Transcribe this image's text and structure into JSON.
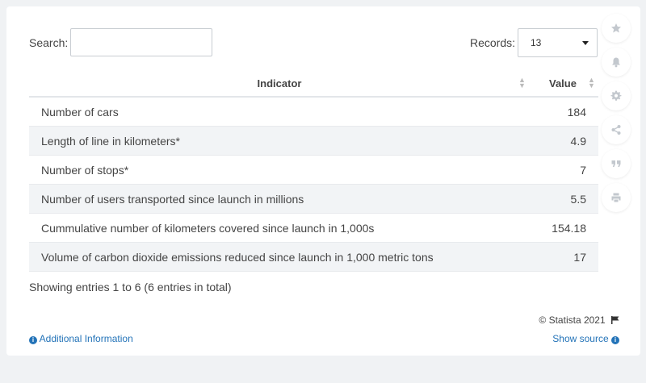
{
  "controls": {
    "search_label": "Search:",
    "search_value": "",
    "records_label": "Records:",
    "records_value": "13"
  },
  "table": {
    "headers": [
      "Indicator",
      "Value"
    ],
    "rows": [
      {
        "indicator": "Number of cars",
        "value": "184"
      },
      {
        "indicator": "Length of line in kilometers*",
        "value": "4.9"
      },
      {
        "indicator": "Number of stops*",
        "value": "7"
      },
      {
        "indicator": "Number of users transported since launch in millions",
        "value": "5.5"
      },
      {
        "indicator": "Cummulative number of kilometers covered since launch in 1,000s",
        "value": "154.18"
      },
      {
        "indicator": "Volume of carbon dioxide emissions reduced since launch in 1,000 metric tons",
        "value": "17"
      }
    ]
  },
  "footer": {
    "entries_info": "Showing entries 1 to 6 (6 entries in total)",
    "copyright": "© Statista 2021",
    "additional_info": "Additional Information",
    "show_source": "Show source"
  },
  "sidebar_icons": [
    "star-icon",
    "bell-icon",
    "gear-icon",
    "share-icon",
    "quote-icon",
    "print-icon"
  ],
  "colors": {
    "link": "#2373b8",
    "row_alt": "#f2f4f6",
    "icon": "#c3c8ce"
  }
}
